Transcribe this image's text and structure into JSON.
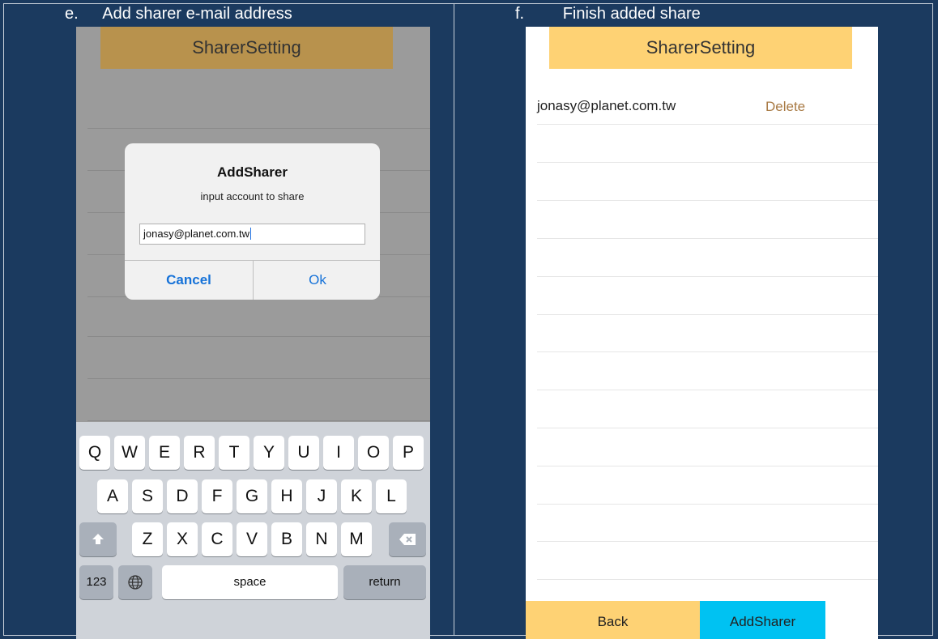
{
  "captions": {
    "left_letter": "e.",
    "left_text": "Add sharer e-mail address",
    "right_letter": "f.",
    "right_text": "Finish added share"
  },
  "left_screen": {
    "title": "SharerSetting",
    "dialog": {
      "title": "AddSharer",
      "message": "input account to share",
      "input_value": "jonasy@planet.com.tw",
      "cancel_label": "Cancel",
      "ok_label": "Ok"
    },
    "keyboard": {
      "row1": [
        "Q",
        "W",
        "E",
        "R",
        "T",
        "Y",
        "U",
        "I",
        "O",
        "P"
      ],
      "row2": [
        "A",
        "S",
        "D",
        "F",
        "G",
        "H",
        "J",
        "K",
        "L"
      ],
      "row3": [
        "Z",
        "X",
        "C",
        "V",
        "B",
        "N",
        "M"
      ],
      "numbers_label": "123",
      "space_label": "space",
      "return_label": "return"
    }
  },
  "right_screen": {
    "title": "SharerSetting",
    "sharers": [
      {
        "email": "jonasy@planet.com.tw",
        "delete_label": "Delete"
      }
    ],
    "back_label": "Back",
    "add_label": "AddSharer"
  },
  "colors": {
    "page_bg": "#1b3a5f",
    "left_title_bg": "#b8924d",
    "right_title_bg": "#fed274",
    "add_button_bg": "#00c2f2",
    "link_blue": "#1672d8",
    "delete_brown": "#a87a44"
  },
  "icons": {
    "shift": "shift-icon",
    "backspace": "backspace-icon",
    "globe": "globe-icon"
  }
}
